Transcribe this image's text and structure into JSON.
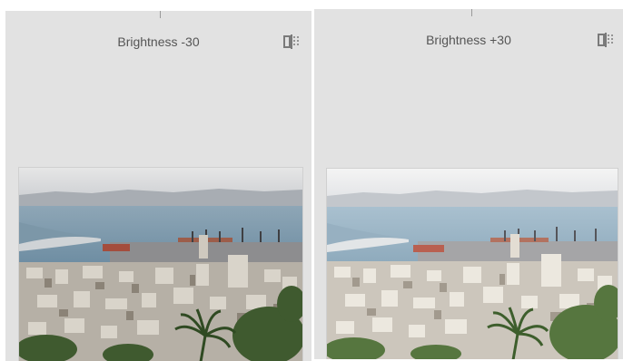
{
  "panels": [
    {
      "id": "left",
      "label": "Brightness -30",
      "brightness": -30,
      "compare_icon": "compare-split-icon"
    },
    {
      "id": "right",
      "label": "Brightness +30",
      "brightness": 30,
      "compare_icon": "compare-split-icon"
    }
  ],
  "colors": {
    "accent": "#3b78e7",
    "panel_bg": "#e2e2e2"
  }
}
